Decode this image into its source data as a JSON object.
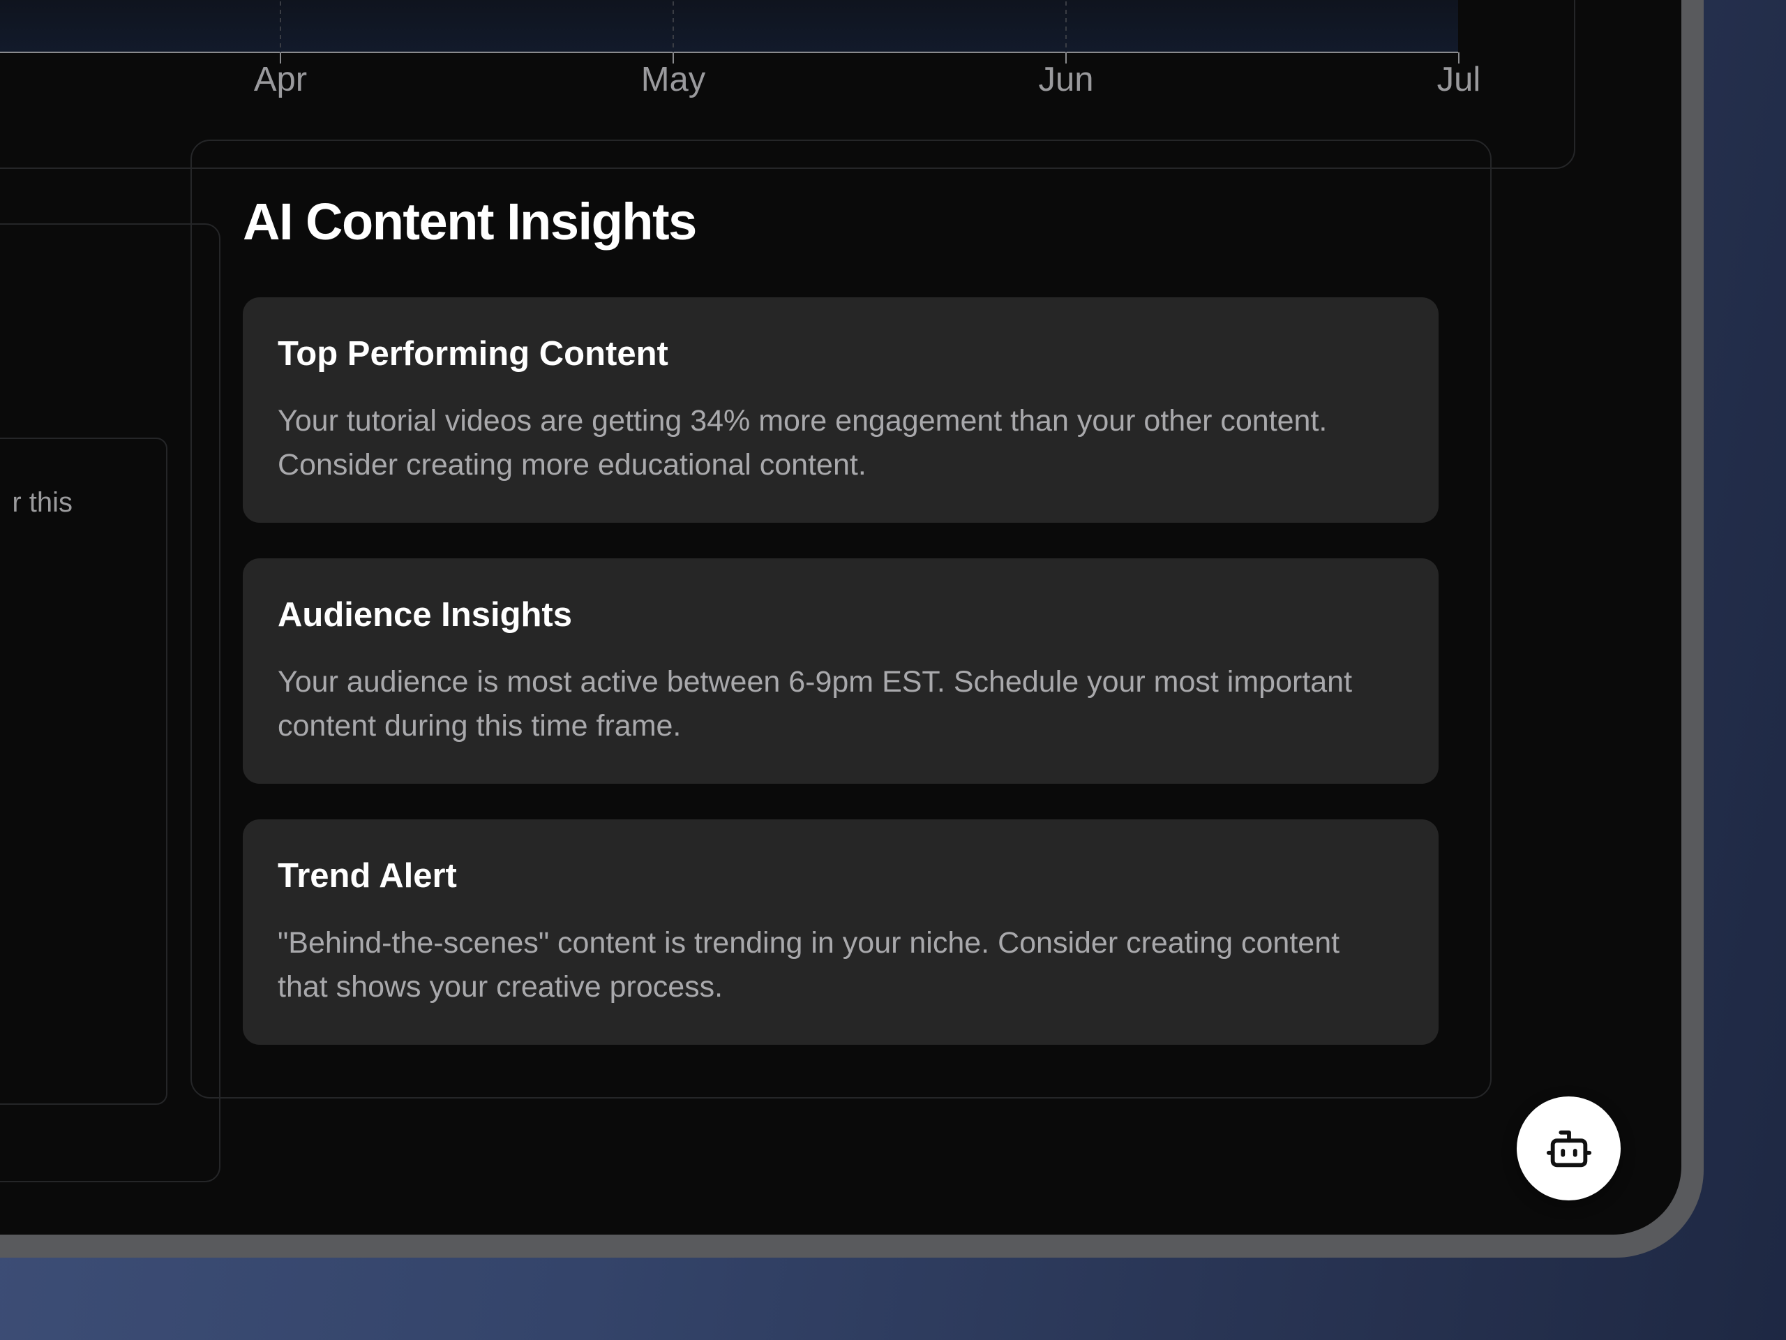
{
  "chart": {
    "x_ticks": [
      "Apr",
      "May",
      "Jun",
      "Jul"
    ]
  },
  "chart_data": {
    "type": "area",
    "categories": [
      "Apr",
      "May",
      "Jun",
      "Jul"
    ],
    "title": "",
    "xlabel": "",
    "ylabel": "",
    "grid": "vertical dashed lines"
  },
  "left_panel": {
    "fragment_text": "r this"
  },
  "insights": {
    "title": "AI Content Insights",
    "items": [
      {
        "title": "Top Performing Content",
        "text": "Your tutorial videos are getting 34% more engagement than your other content. Consider creating more educational content."
      },
      {
        "title": "Audience Insights",
        "text": "Your audience is most active between 6-9pm EST. Schedule your most important content during this time frame."
      },
      {
        "title": "Trend Alert",
        "text": "\"Behind-the-scenes\" content is trending in your niche. Consider creating content that shows your creative process."
      }
    ]
  },
  "assistant_button": {
    "icon": "bot-icon"
  },
  "colors": {
    "background": "#0a0a0a",
    "card_border": "#252628",
    "insight_bg": "#262626",
    "text_primary": "#ffffff",
    "text_secondary": "#a9a9ac",
    "axis_label": "#9a9a9d",
    "page_gradient": "#3f5079"
  }
}
